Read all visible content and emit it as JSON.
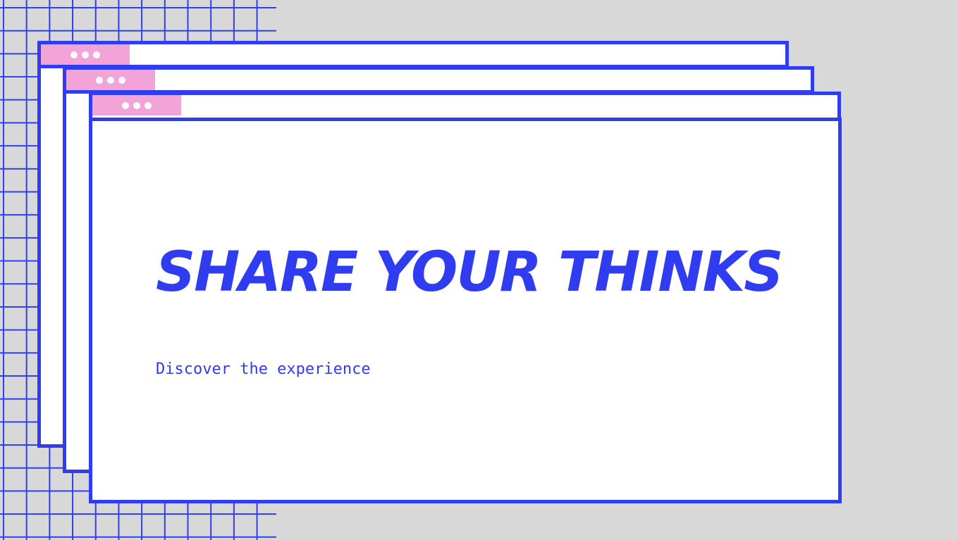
{
  "colors": {
    "background": "#d8d8d8",
    "accent": "#2f3cf0",
    "tab": "#f2a4d8",
    "window": "#ffffff"
  },
  "hero": {
    "title": "SHARE YOUR THINKS",
    "subtitle": "Discover the experience"
  },
  "windows": [
    {
      "tab_icon": "three-dots-icon"
    },
    {
      "tab_icon": "three-dots-icon"
    },
    {
      "tab_icon": "three-dots-icon"
    }
  ]
}
